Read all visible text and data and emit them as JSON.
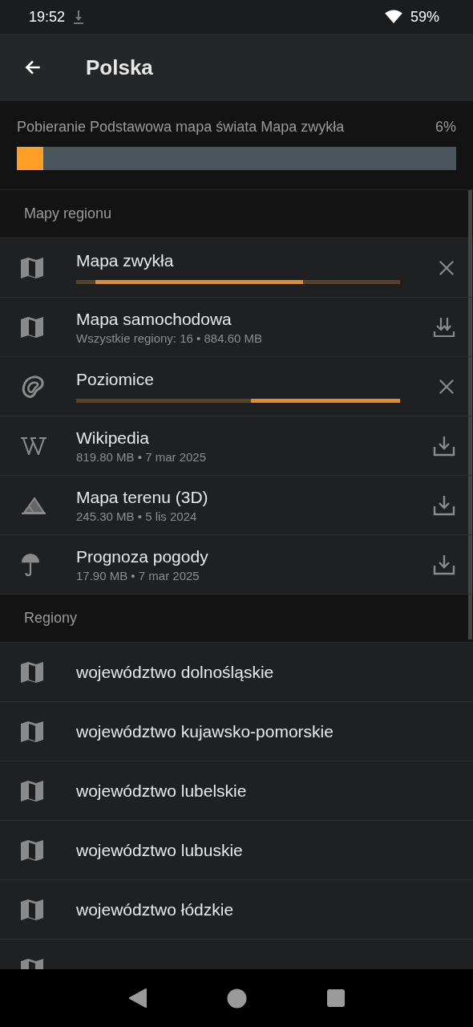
{
  "status_bar": {
    "time": "19:52",
    "battery": "59%"
  },
  "toolbar": {
    "title": "Polska"
  },
  "download": {
    "label": "Pobieranie Podstawowa mapa świata Mapa zwykła",
    "percent": "6%",
    "level": 0.06
  },
  "sections": [
    {
      "title": "Mapy regionu",
      "items": [
        {
          "kind": "standard",
          "title": "Mapa zwykła"
        },
        {
          "kind": "car",
          "title": "Mapa samochodowa",
          "subtitle": "Wszystkie regiony: 16 • 884.60 MB"
        },
        {
          "kind": "contours",
          "title": "Poziomice"
        },
        {
          "kind": "wikipedia",
          "title": "Wikipedia",
          "subtitle": "819.80 MB • 7 mar 2025"
        },
        {
          "kind": "terrain",
          "title": "Mapa terenu (3D)",
          "subtitle": "245.30 MB • 5 lis 2024"
        },
        {
          "kind": "weather",
          "title": "Prognoza pogody",
          "subtitle": "17.90 MB • 7 mar 2025"
        }
      ]
    },
    {
      "title": "Regiony",
      "items": [
        {
          "kind": "region",
          "title": "województwo dolnośląskie"
        },
        {
          "kind": "region",
          "title": "województwo kujawsko-pomorskie"
        },
        {
          "kind": "region",
          "title": "województwo lubelskie"
        },
        {
          "kind": "region",
          "title": "województwo lubuskie"
        },
        {
          "kind": "region",
          "title": "województwo łódzkie"
        },
        {
          "kind": "region"
        }
      ]
    }
  ]
}
